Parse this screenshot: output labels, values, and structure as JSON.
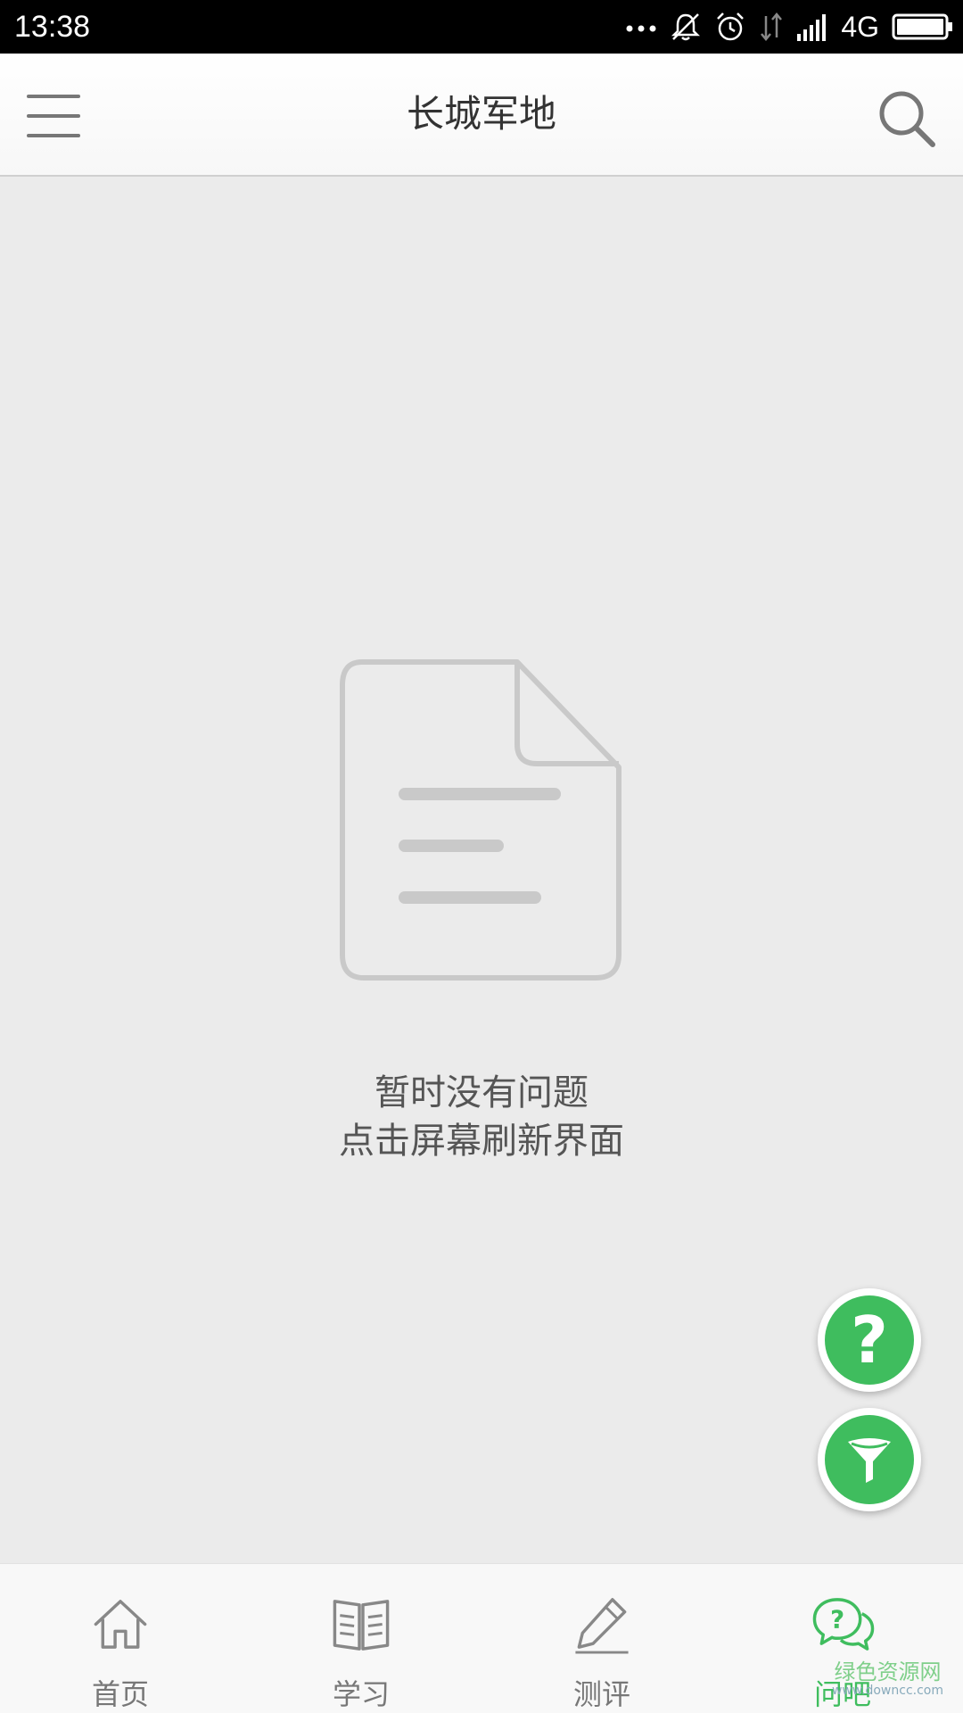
{
  "status_bar": {
    "time": "13:38",
    "network": "4G",
    "icons": [
      "more-dots-icon",
      "mute-icon",
      "alarm-icon",
      "data-arrows-icon",
      "signal-icon",
      "battery-icon"
    ]
  },
  "app_bar": {
    "title": "长城军地",
    "menu_icon": "menu-icon",
    "search_icon": "search-icon"
  },
  "empty_state": {
    "icon": "document-icon",
    "line1": "暂时没有问题",
    "line2": "点击屏幕刷新界面"
  },
  "fabs": {
    "ask_icon": "question-mark-icon",
    "ask_glyph": "?",
    "filter_icon": "filter-icon"
  },
  "bottom_nav": {
    "items": [
      {
        "label": "首页",
        "icon": "home-icon"
      },
      {
        "label": "学习",
        "icon": "book-icon"
      },
      {
        "label": "测评",
        "icon": "pencil-icon"
      },
      {
        "label": "问吧",
        "icon": "chat-question-icon",
        "active": true
      }
    ]
  },
  "watermark": {
    "main": "绿色资源网",
    "sub": "www.downcc.com"
  },
  "colors": {
    "accent": "#3fbd5e",
    "background": "#ebebeb",
    "status_bar": "#000000"
  }
}
